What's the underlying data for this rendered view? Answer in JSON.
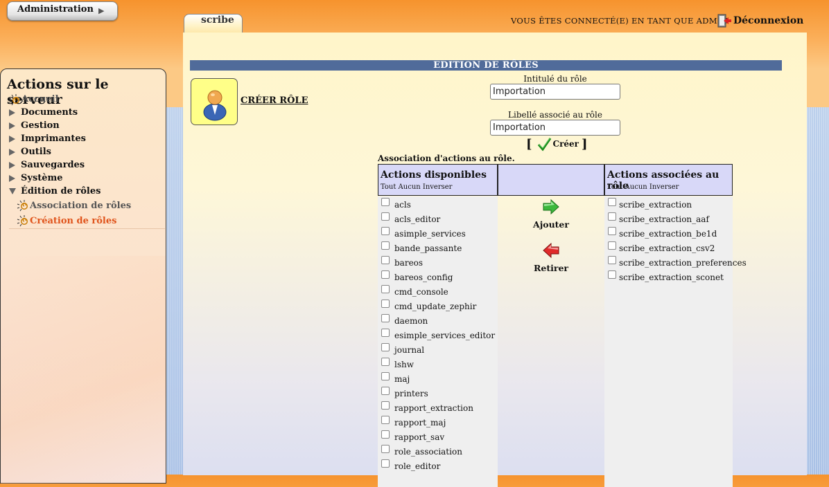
{
  "header": {
    "admin_tab": "Administration",
    "scribe_tab": "scribe",
    "connected_text": "VOUS ÊTES CONNECTÉ(E) EN TANT QUE ADMIN",
    "logout": "Déconnexion"
  },
  "sidebar": {
    "title": "Actions sur le serveur",
    "home": "Accueil",
    "items": [
      "Documents",
      "Gestion",
      "Imprimantes",
      "Outils",
      "Sauvegardes",
      "Système"
    ],
    "expanded": "Édition de rôles",
    "subitems": [
      "Association de rôles",
      "Création de rôles"
    ],
    "active_subitem": "Création de rôles"
  },
  "main": {
    "banner": "EDITION DE RÔLES",
    "create_role_link": "CRÉER RÔLE",
    "role_title_label": "Intitulé du rôle",
    "role_title_value": "Importation",
    "role_label_label": "Libellé associé au rôle",
    "role_label_value": "Importation",
    "create_open": "[",
    "create_button": "Créer",
    "create_close": "]",
    "association_title": "Association d'actions au rôle.",
    "available": {
      "header": "Actions disponibles",
      "select_links": "Tout Aucun Inverser",
      "items": [
        "acls",
        "acls_editor",
        "asimple_services",
        "bande_passante",
        "bareos",
        "bareos_config",
        "cmd_console",
        "cmd_update_zephir",
        "daemon",
        "esimple_services_editor",
        "journal",
        "lshw",
        "maj",
        "printers",
        "rapport_extraction",
        "rapport_maj",
        "rapport_sav",
        "role_association",
        "role_editor"
      ]
    },
    "associated": {
      "header": "Actions associées au rôle",
      "select_links": "Tout Aucun Inverser",
      "items": [
        "scribe_extraction",
        "scribe_extraction_aaf",
        "scribe_extraction_be1d",
        "scribe_extraction_csv2",
        "scribe_extraction_preferences",
        "scribe_extraction_sconet"
      ]
    },
    "add_button": "Ajouter",
    "remove_button": "Retirer"
  },
  "colors": {
    "banner": "#506b9a",
    "active_link": "#e0541c",
    "header_orange": "#f6932d"
  }
}
